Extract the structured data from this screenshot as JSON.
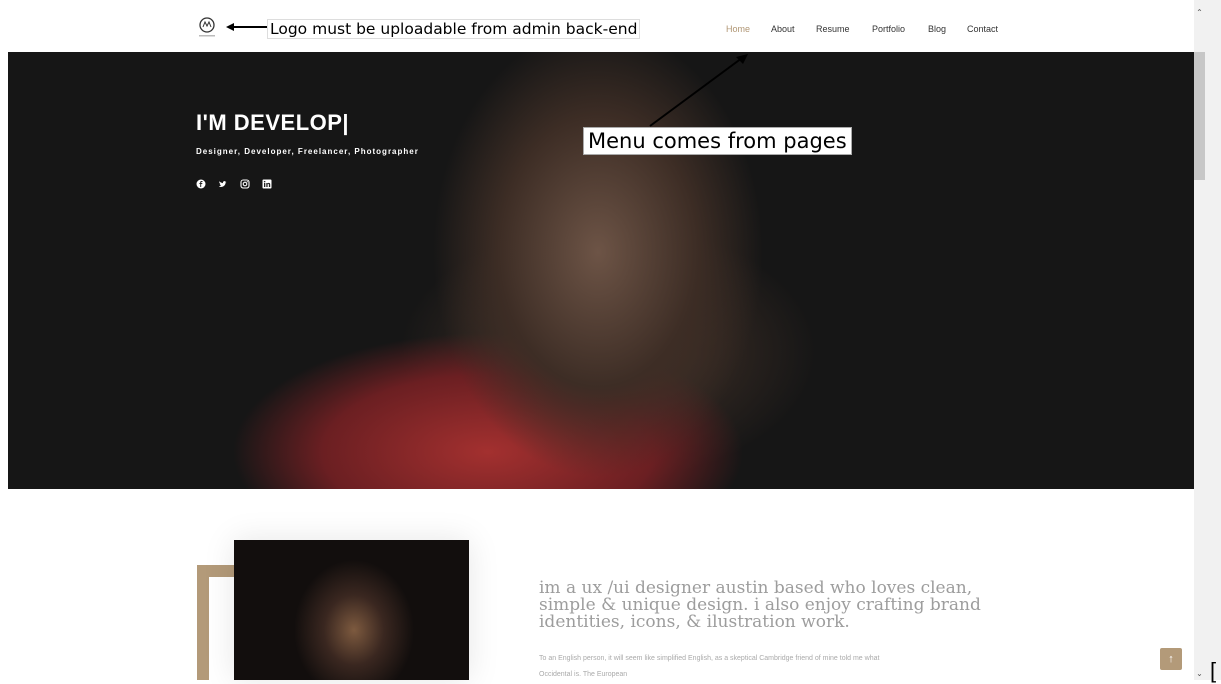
{
  "header": {
    "logo_icon": "logo-monogram-icon",
    "logo_annotation": "Logo must be uploadable from admin back-end",
    "nav": [
      {
        "label": "Home",
        "active": true
      },
      {
        "label": "About",
        "active": false
      },
      {
        "label": "Resume",
        "active": false
      },
      {
        "label": "Portfolio",
        "active": false
      },
      {
        "label": "Blog",
        "active": false
      },
      {
        "label": "Contact",
        "active": false
      }
    ],
    "menu_annotation": "Menu comes from pages"
  },
  "hero": {
    "title": "I'M DEVELOP|",
    "subtitle": "Designer, Developer, Freelancer, Photographer",
    "socials": [
      "facebook-icon",
      "twitter-icon",
      "instagram-icon",
      "linkedin-icon"
    ]
  },
  "about": {
    "heading": "im a ux /ui designer austin based who loves clean, simple & unique design. i also enjoy crafting brand identities, icons, & ilustration work.",
    "body": "To an English person, it will seem like simplified English, as a skeptical Cambridge friend of mine told me what Occidental is. The European"
  },
  "ui": {
    "back_to_top": "↑",
    "scroll_up": "⌃",
    "scroll_down": "⌄",
    "bracket": "["
  },
  "colors": {
    "accent": "#b09674",
    "frame": "#b39a79"
  }
}
